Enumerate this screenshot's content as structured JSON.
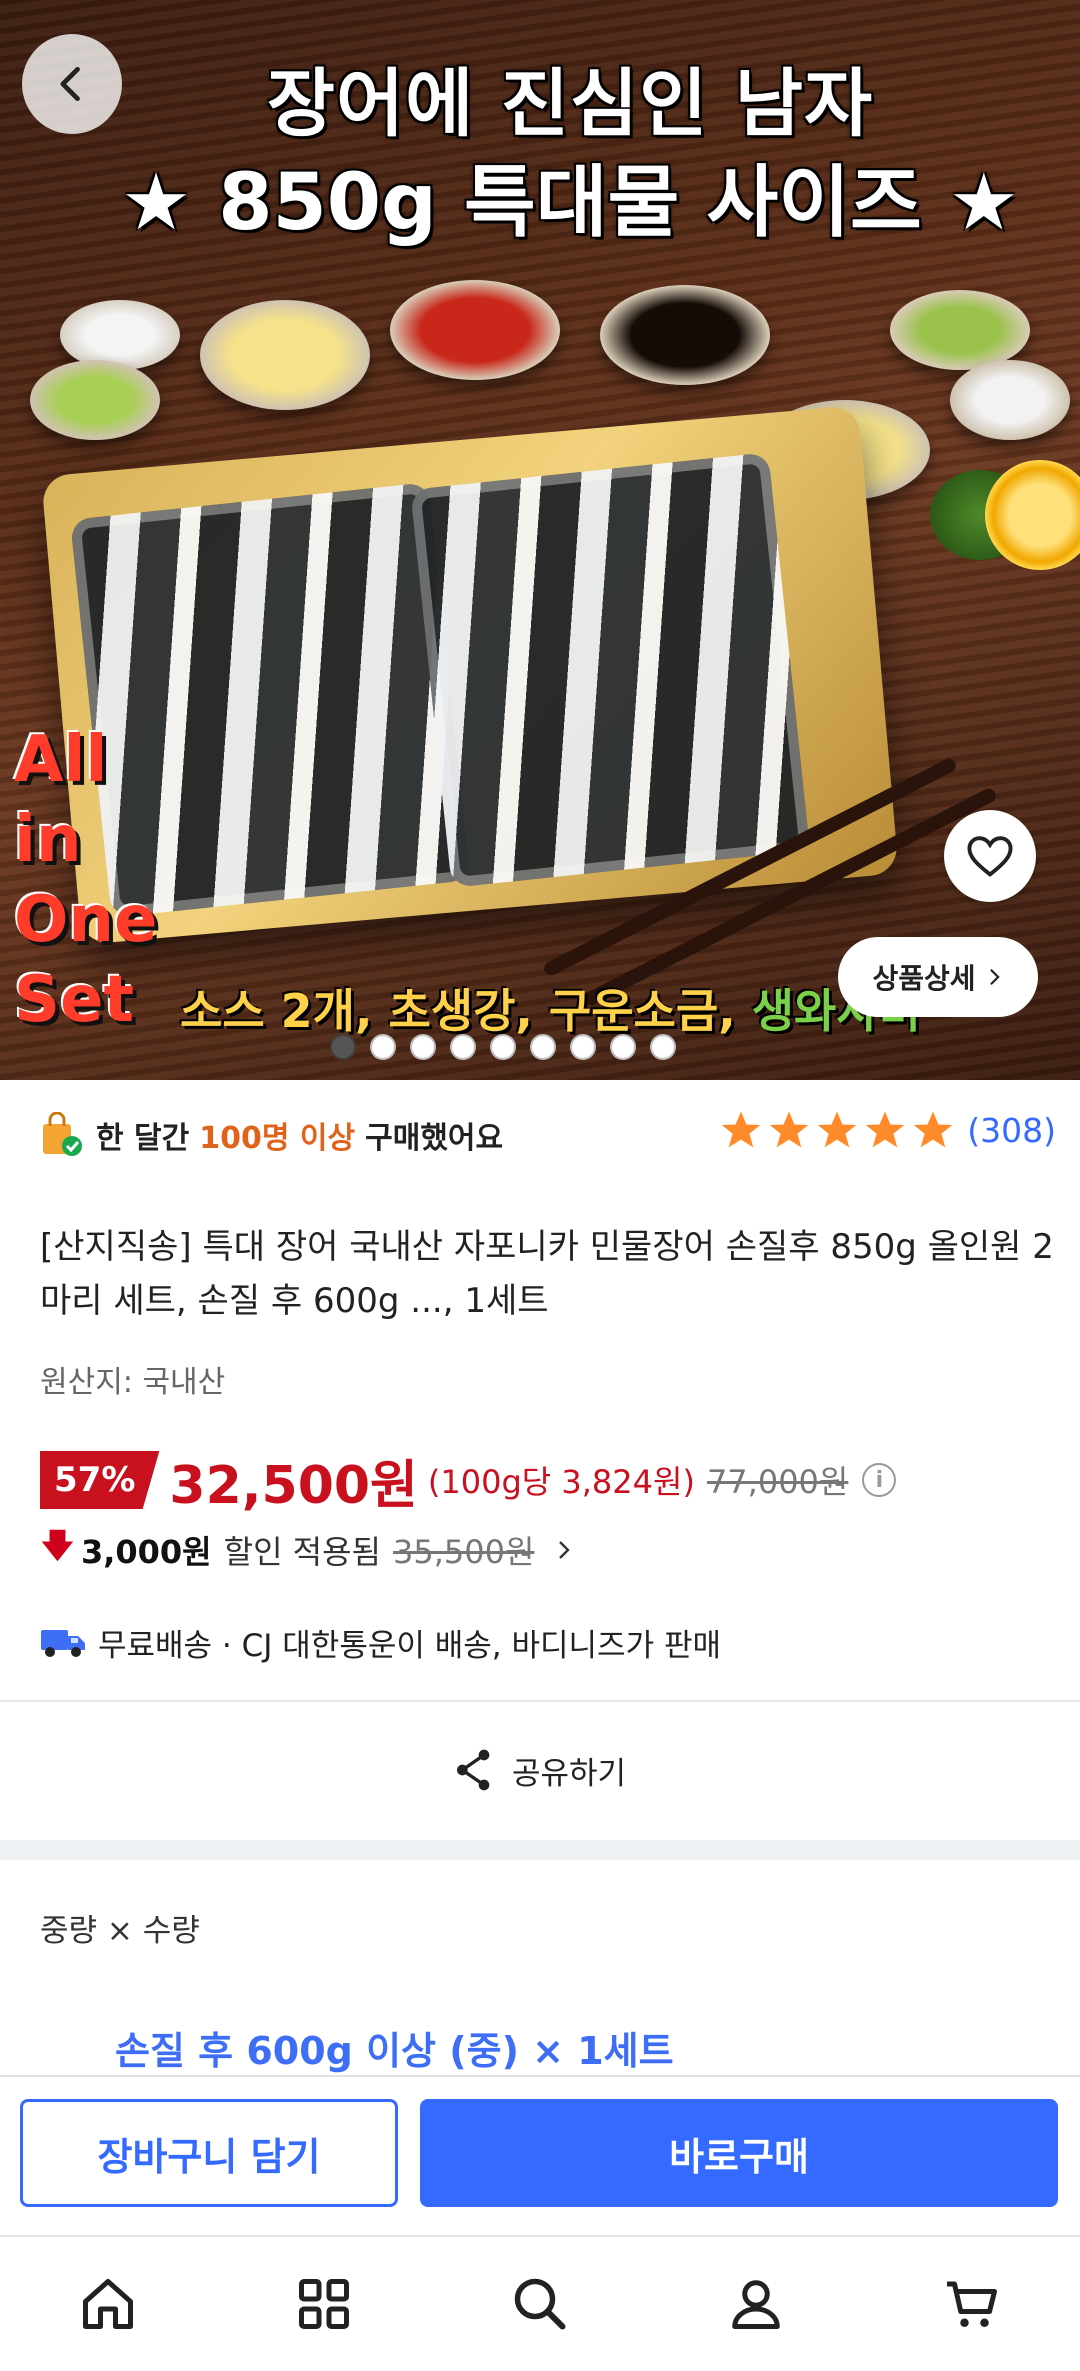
{
  "hero": {
    "title_line1": "장어에 진심인 남자",
    "title_line2": "★ 850g 특대물 사이즈 ★",
    "side_text": [
      "All",
      "in",
      "One",
      "Set"
    ],
    "banner_text": "소스 2개, 초생강, 구운소금, ",
    "banner_text_green": "생와사비",
    "detail_button": "상품상세",
    "slide_count": 9,
    "active_slide": 1
  },
  "social": {
    "prefix": "한 달간 ",
    "highlight": "100명 이상",
    "suffix": " 구매했어요",
    "rating_stars": 5,
    "review_count": "(308)"
  },
  "product": {
    "title": "[산지직송] 특대 장어 국내산 자포니카 민물장어 손질후 850g 올인원 2마리 세트, 손질 후 600g ..., 1세트",
    "origin": "원산지: 국내산"
  },
  "price": {
    "discount_pct": "57%",
    "sale_price": "32,500원",
    "unit_price": "(100g당 3,824원)",
    "original_price": "77,000원",
    "extra_discount": "3,000원",
    "extra_label": "할인 적용됨",
    "pre_extra_price": "35,500원"
  },
  "shipping": {
    "text": "무료배송 · CJ 대한통운이 배송, 바디니즈가 판매"
  },
  "share": {
    "label": "공유하기"
  },
  "option": {
    "label": "중량 × 수량",
    "selected": "손질 후 600g 이상 (중) × 1세트"
  },
  "actions": {
    "cart_label": "장바구니 담기",
    "buy_label": "바로구매"
  },
  "colors": {
    "brand_blue": "#346aff",
    "discount_red": "#c9101e",
    "star_orange": "#ff8a2a"
  },
  "tabs": [
    "home-icon",
    "category-icon",
    "search-icon",
    "my-page-icon",
    "cart-icon"
  ]
}
